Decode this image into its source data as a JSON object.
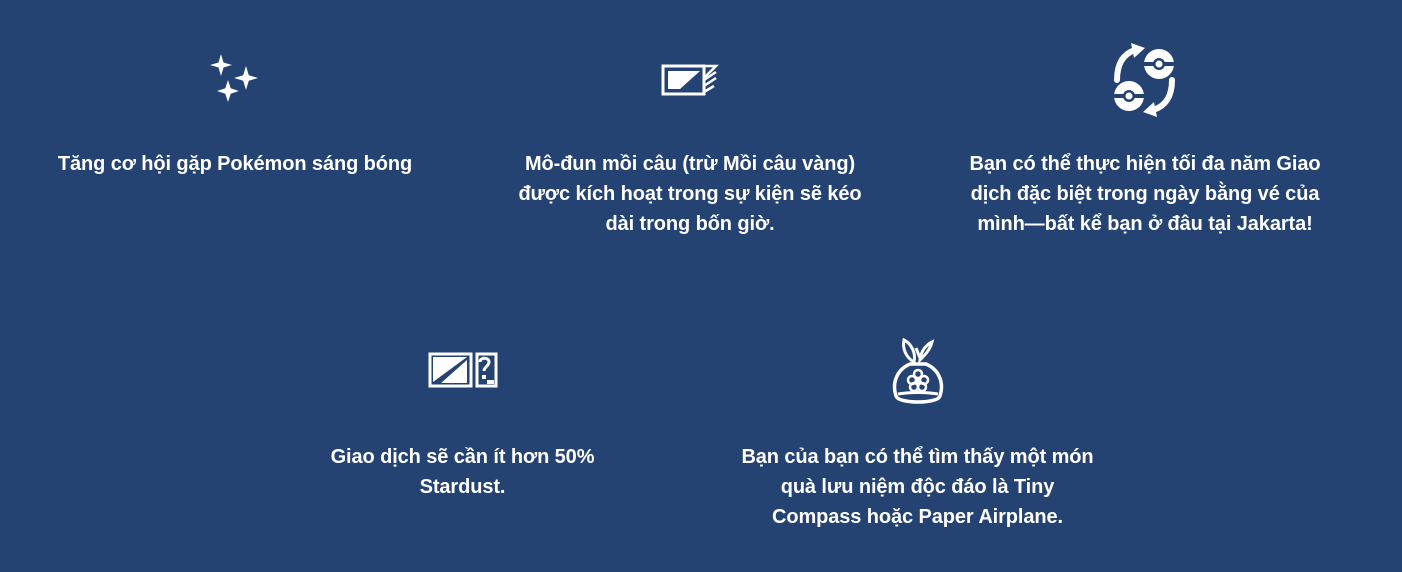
{
  "colors": {
    "background": "#244272",
    "text": "#ffffff"
  },
  "features": [
    {
      "icon": "sparkles-icon",
      "text": "Tăng cơ hội gặp Pokémon sáng bóng"
    },
    {
      "icon": "lure-module-icon",
      "text": "Mô-đun mồi câu (trừ Mồi câu vàng) được kích hoạt trong sự kiện sẽ kéo dài trong bốn giờ."
    },
    {
      "icon": "trade-arrows-icon",
      "text": "Bạn có thể thực hiện tối đa năm Giao dịch đặc biệt trong ngày bằng vé của mình—bất kể bạn ở đâu tại Jakarta!"
    },
    {
      "icon": "stardust-trade-icon",
      "text": "Giao dịch sẽ cần ít hơn 50% Stardust."
    },
    {
      "icon": "gift-bag-icon",
      "text": "Bạn của bạn có thể tìm thấy một món quà lưu niệm độc đáo là Tiny Compass hoặc Paper Airplane."
    }
  ]
}
